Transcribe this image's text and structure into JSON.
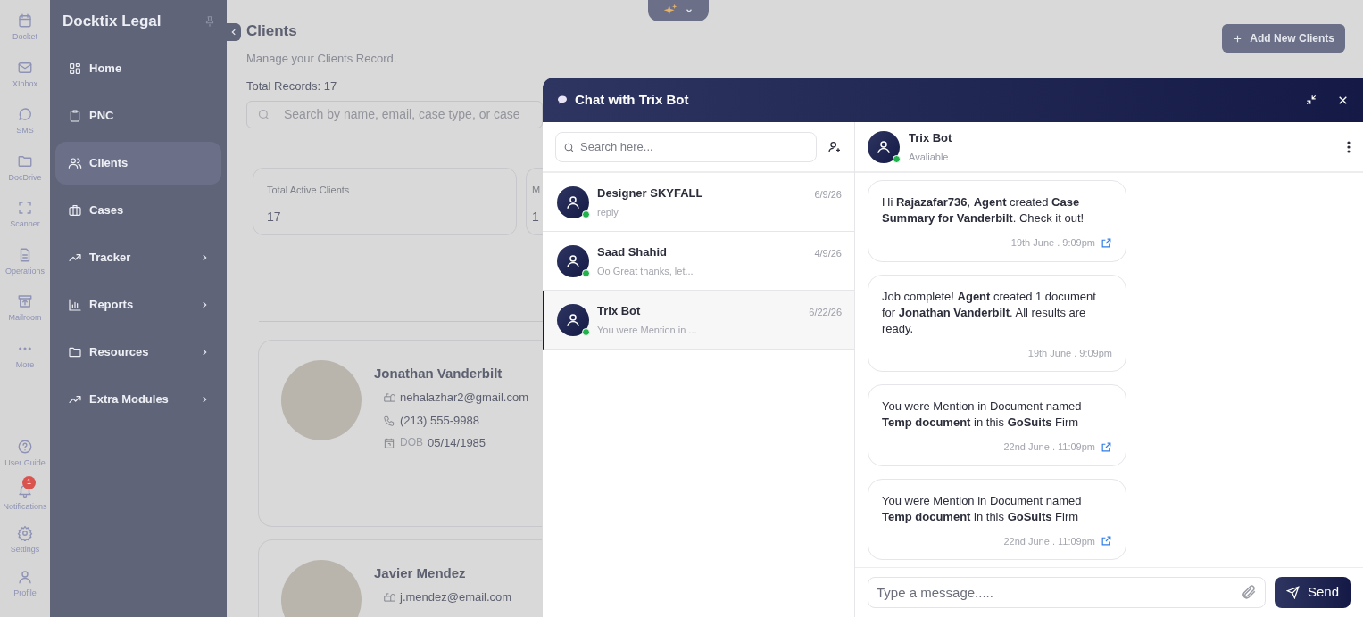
{
  "rail": {
    "items": [
      {
        "label": "Docket"
      },
      {
        "label": "XInbox"
      },
      {
        "label": "SMS"
      },
      {
        "label": "DocDrive"
      },
      {
        "label": "Scanner"
      },
      {
        "label": "Operations"
      },
      {
        "label": "Mailroom"
      },
      {
        "label": "More"
      }
    ],
    "bottom_items": [
      {
        "label": "User Guide"
      },
      {
        "label": "Notifications",
        "badge": "1"
      },
      {
        "label": "Settings"
      },
      {
        "label": "Profile"
      }
    ]
  },
  "sidebar": {
    "title": "Docktix Legal",
    "items": [
      {
        "label": "Home",
        "selected": false,
        "has_submenu": false
      },
      {
        "label": "PNC",
        "selected": false,
        "has_submenu": false
      },
      {
        "label": "Clients",
        "selected": true,
        "has_submenu": false
      },
      {
        "label": "Cases",
        "selected": false,
        "has_submenu": false
      },
      {
        "label": "Tracker",
        "selected": false,
        "has_submenu": true
      },
      {
        "label": "Reports",
        "selected": false,
        "has_submenu": true
      },
      {
        "label": "Resources",
        "selected": false,
        "has_submenu": true
      },
      {
        "label": "Extra Modules",
        "selected": false,
        "has_submenu": true
      }
    ]
  },
  "main": {
    "title": "Clients",
    "subtitle": "Manage your Clients Record.",
    "total_records": "Total Records: 17",
    "search": {
      "placeholder": "Search by name, email, case type, or case"
    },
    "add_button": "Add New Clients",
    "stats": [
      {
        "label": "Total Active Clients",
        "value": "17"
      },
      {
        "label": "M",
        "value": "1"
      }
    ],
    "clients": [
      {
        "name": "Jonathan Vanderbilt",
        "email": "nehalazhar2@gmail.com",
        "phone": "(213) 555-9988",
        "dob_label": "DOB",
        "dob": "05/14/1985"
      },
      {
        "name": "Javier Mendez",
        "email": "j.mendez@email.com"
      }
    ]
  },
  "chat": {
    "title": "Chat with Trix Bot",
    "search": {
      "placeholder": "Search here..."
    },
    "conversations": [
      {
        "name": "Designer SKYFALL",
        "preview": "reply",
        "date": "6/9/26",
        "selected": false,
        "online": true
      },
      {
        "name": "Saad Shahid",
        "preview": "Oo Great thanks, let...",
        "date": "4/9/26",
        "selected": false,
        "online": true
      },
      {
        "name": "Trix Bot",
        "preview": "You were Mention in ...",
        "date": "6/22/26",
        "selected": true,
        "online": true
      }
    ],
    "contact": {
      "name": "Trix Bot",
      "status": "Avaliable",
      "online": true
    },
    "messages": [
      {
        "text": "Hi **Rajazafar736**, **Agent** created **Case Summary for Vanderbilt**. Check it out!",
        "time": "19th June . 9:09pm",
        "has_link": true
      },
      {
        "text": "Job complete! **Agent** created 1 document for **Jonathan Vanderbilt**. All results are ready.",
        "time": "19th June . 9:09pm",
        "has_link": false
      },
      {
        "text": "You were Mention in Document named **Temp document** in this **GoSuits** Firm",
        "time": "22nd June . 11:09pm",
        "has_link": true
      },
      {
        "text": "You were Mention in Document named **Temp document** in this **GoSuits** Firm",
        "time": "22nd June . 11:09pm",
        "has_link": true
      }
    ],
    "input": {
      "placeholder": "Type a message....."
    },
    "send_button": "Send"
  }
}
